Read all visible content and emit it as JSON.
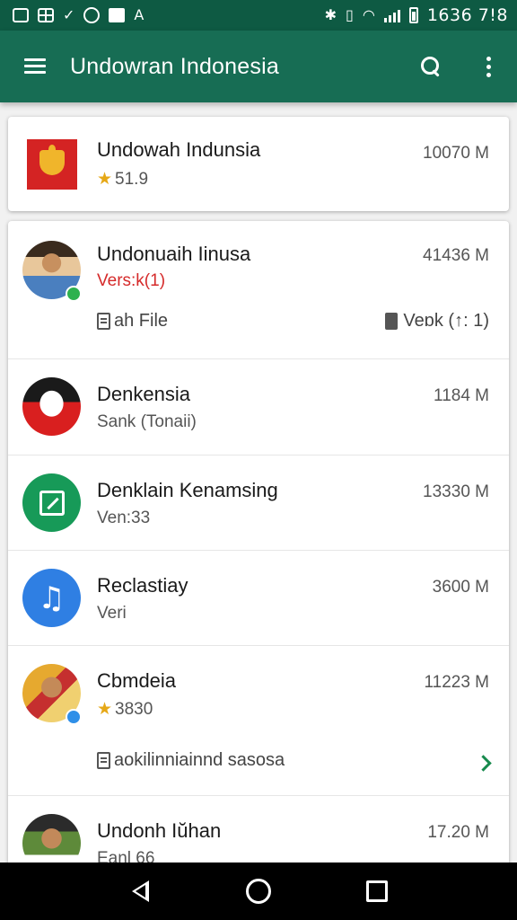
{
  "status_bar": {
    "time": "1636 7!8",
    "left_icons": [
      "square-icon",
      "grid-icon",
      "check-icon",
      "circle-icon",
      "photo-icon",
      "text-icon"
    ],
    "right_icons": [
      "bluetooth-icon",
      "vibrate-icon",
      "wifi-icon",
      "signal-icon",
      "battery-icon"
    ]
  },
  "app_bar": {
    "title": "Undowran Indonesia",
    "color": "#176d54"
  },
  "featured": {
    "title": "Undowah Indunsia",
    "rating": "51.9",
    "size": "10070 M"
  },
  "list": [
    {
      "title": "Undonuaih Iinusa",
      "subtitle": "Vers:k(1)",
      "size": "41436 M",
      "extra_left": "ah File",
      "extra_right": "Veɒk (↑: 1)"
    },
    {
      "title": "Denkensia",
      "subtitle": "Sank (Tonaii)",
      "size": "1184 M"
    },
    {
      "title": "Denklain Kenamsing",
      "subtitle": "Ven:33",
      "size": "13330 M"
    },
    {
      "title": "Reclastiay",
      "subtitle": "Veri",
      "size": "3600 M"
    },
    {
      "title": "Cbmdeia",
      "rating": "3830",
      "size": "11223 M",
      "extra_left": "aokilinniainnd sasosa"
    },
    {
      "title": "Undonh Iŭhan",
      "subtitle": "Eanl 66",
      "size": "17.20 M"
    }
  ],
  "music_glyph": "♫",
  "star_glyph": "★",
  "accent_green": "#178a4d",
  "red_text": "#d52a2a"
}
